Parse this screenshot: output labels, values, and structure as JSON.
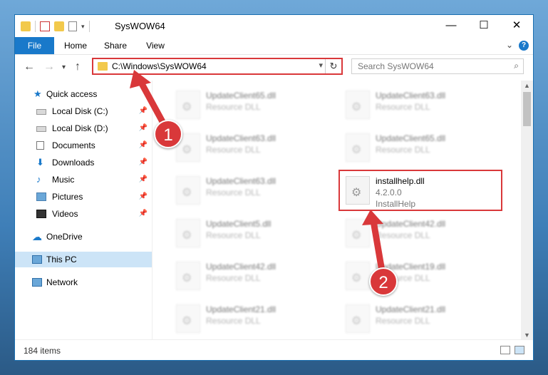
{
  "window": {
    "title": "SysWOW64",
    "controls": {
      "minimize": "—",
      "maximize": "☐",
      "close": "✕"
    }
  },
  "ribbon": {
    "tabs": [
      "File",
      "Home",
      "Share",
      "View"
    ],
    "help": "?"
  },
  "navbar": {
    "back": "←",
    "forward": "→",
    "recent": "▾",
    "up": "↑",
    "address": "C:\\Windows\\SysWOW64",
    "address_dropdown": "▾",
    "refresh": "↻",
    "search_placeholder": "Search SysWOW64",
    "search_icon": "⌕"
  },
  "sidebar": {
    "quick_access": "Quick access",
    "items": [
      {
        "label": "Local Disk (C:)",
        "pinned": true
      },
      {
        "label": "Local Disk (D:)",
        "pinned": true
      },
      {
        "label": "Documents",
        "pinned": true
      },
      {
        "label": "Downloads",
        "pinned": true
      },
      {
        "label": "Music",
        "pinned": true
      },
      {
        "label": "Pictures",
        "pinned": true
      },
      {
        "label": "Videos",
        "pinned": true
      }
    ],
    "onedrive": "OneDrive",
    "this_pc": "This PC",
    "network": "Network"
  },
  "files": [
    {
      "name": "UpdateClient65.dll",
      "type": "Resource DLL"
    },
    {
      "name": "UpdateClient63.dll",
      "type": "Resource DLL"
    },
    {
      "name": "UpdateClient63.dll",
      "type": "Resource DLL"
    },
    {
      "name": "UpdateClient65.dll",
      "type": "Resource DLL"
    },
    {
      "name": "UpdateClient63.dll",
      "type": "Resource DLL"
    },
    {
      "name": "installhelp.dll",
      "version": "4.2.0.0",
      "type": "InstallHelp"
    },
    {
      "name": "UpdateClient5.dll",
      "type": "Resource DLL"
    },
    {
      "name": "UpdateClient42.dll",
      "type": "Resource DLL"
    },
    {
      "name": "UpdateClient42.dll",
      "type": "Resource DLL"
    },
    {
      "name": "UpdateClient19.dll",
      "type": "Resource DLL"
    },
    {
      "name": "UpdateClient21.dll",
      "type": "Resource DLL"
    },
    {
      "name": "UpdateClient21.dll",
      "type": "Resource DLL"
    }
  ],
  "status": {
    "count": "184 items"
  },
  "annotations": {
    "step1": "1",
    "step2": "2"
  },
  "colors": {
    "accent": "#1979ca",
    "annotation": "#d9383a",
    "selected": "#cce4f7"
  }
}
